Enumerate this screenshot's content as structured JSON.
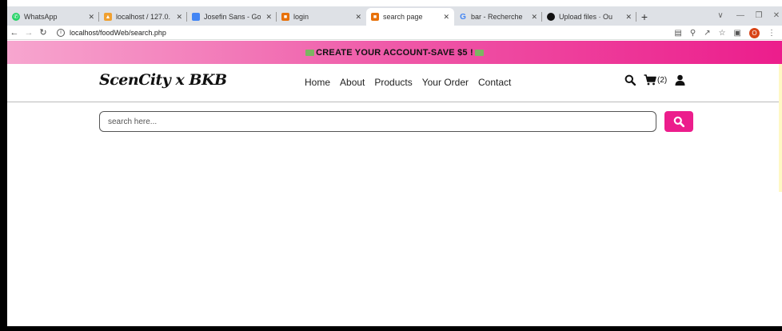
{
  "browser": {
    "tabs": [
      {
        "label": "WhatsApp",
        "favicon": "whatsapp-icon",
        "color": "#25d366"
      },
      {
        "label": "localhost / 127.0.",
        "favicon": "phpmyadmin-icon",
        "color": "#f0a030"
      },
      {
        "label": "Josefin Sans - Go",
        "favicon": "google-fonts-icon",
        "color": "#4285f4"
      },
      {
        "label": "login",
        "favicon": "page-icon",
        "color": "#e8710a"
      },
      {
        "label": "search page",
        "favicon": "page-icon",
        "color": "#e8710a",
        "active": true
      },
      {
        "label": "bar - Recherche",
        "favicon": "google-icon",
        "color": "#4285f4"
      },
      {
        "label": "Upload files · Ou",
        "favicon": "github-icon",
        "color": "#111111"
      }
    ],
    "new_tab": "+",
    "url": "localhost/foodWeb/search.php",
    "profile_initial": "O"
  },
  "promo": {
    "text": "CREATE YOUR ACCOUNT-SAVE $5 !"
  },
  "header": {
    "logo": "ScenCity x BKB",
    "nav": [
      "Home",
      "About",
      "Products",
      "Your Order",
      "Contact"
    ],
    "cart_count": "(2)"
  },
  "search": {
    "placeholder": "search here..."
  },
  "colors": {
    "accent": "#ec1d8c",
    "promo_start": "#f7a6cf",
    "promo_end": "#ec1d8c"
  }
}
